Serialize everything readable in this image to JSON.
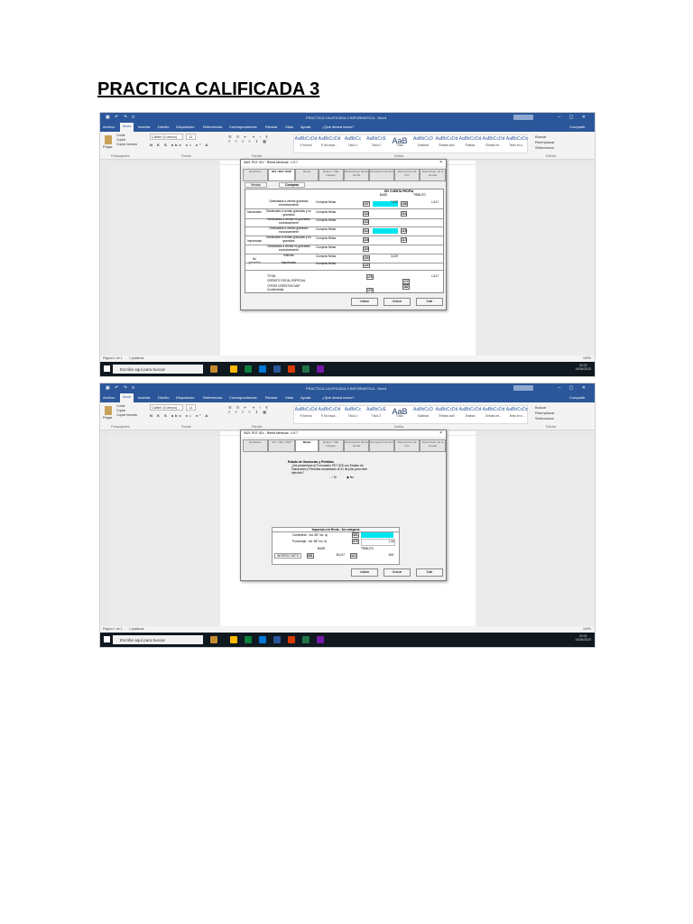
{
  "heading": "PRACTICA CALIFICADA 3",
  "word": {
    "doc_title": "PRACTICA CALIFICADA 3 INFORMATICA - Word",
    "share": "Compartir",
    "tabs": [
      "Archivo",
      "Inicio",
      "Insertar",
      "Diseño",
      "Disposición",
      "Referencias",
      "Correspondencia",
      "Revisar",
      "Vista",
      "Ayuda",
      "¿Qué desea hacer?"
    ],
    "clipboard": {
      "paste": "Pegar",
      "cut": "Cortar",
      "copy": "Copiar",
      "format": "Copiar formato",
      "label": "Portapapeles"
    },
    "font": {
      "name": "Calibri (Cuerpo)",
      "size": "11",
      "label": "Fuente"
    },
    "paragraph_label": "Párrafo",
    "styles_label": "Estilos",
    "edit_label": "Edición",
    "edit_items": [
      "Buscar",
      "Reemplazar",
      "Seleccionar"
    ],
    "styles": [
      {
        "preview": "AaBbCcDd",
        "name": "¶ Normal"
      },
      {
        "preview": "AaBbCcDd",
        "name": "¶ Sin espa..."
      },
      {
        "preview": "AaBbCc",
        "name": "Título 1"
      },
      {
        "preview": "AaBbCcE",
        "name": "Título 2"
      },
      {
        "preview": "AaB",
        "name": "Título"
      },
      {
        "preview": "AaBbCcD",
        "name": "Subtítulo"
      },
      {
        "preview": "AaBbCcDd",
        "name": "Énfasis sutil"
      },
      {
        "preview": "AaBbCcDd",
        "name": "Énfasis"
      },
      {
        "preview": "AaBbCcDd",
        "name": "Énfasis int..."
      },
      {
        "preview": "AaBbCcDc",
        "name": "Texto en n..."
      }
    ],
    "status": {
      "page": "Página 1 de 1",
      "words": "1 palabras",
      "zoom": "100%"
    },
    "taskbar": {
      "search": "Escribe aquí para buscar",
      "time": "20:02",
      "date": "14/06/2023"
    }
  },
  "dialog": {
    "title": "0621 PDT IGV - Renta Mensual - v 5.7",
    "close": "×",
    "tabs": [
      "Identificac.",
      "IGV / IEV / IVAP",
      "Renta",
      "Retenc. Trab. Indepen.",
      "Retenciones Renta de 5ta",
      "Percepción de IGV",
      "Retenciones de IGV",
      "Determinac. de la Deuda"
    ],
    "subtabs": [
      "Ventas",
      "Compras"
    ],
    "buttons": [
      "Validar",
      "Grabar",
      "Salir"
    ]
  },
  "compras": {
    "header_main": "IGV CUENTA PROPIA",
    "header_base": "BASE",
    "header_tributo": "TRIBUTO",
    "groups": [
      "Nacionales",
      "Importadas",
      "No gravadas"
    ],
    "rows": [
      {
        "desc": "Destinadas a ventas gravadas exclusivamente",
        "tipo": "Compras Netas",
        "c1": "107",
        "v1": "7,879",
        "c2": "108",
        "v2": "1,417",
        "cyan": true
      },
      {
        "desc": "Destinadas a ventas gravadas y no gravadas",
        "tipo": "Compras Netas",
        "c1": "110",
        "v1": "",
        "c2": "111",
        "v2": "",
        "cyan": false
      },
      {
        "desc": "Destinadas a ventas no gravadas exclusivamente",
        "tipo": "Compras Netas",
        "c1": "113",
        "v1": "",
        "c2": "",
        "v2": "",
        "cyan": false
      },
      {
        "desc": "Destinadas a ventas gravadas exclusivamente",
        "tipo": "Compras Netas",
        "c1": "114",
        "v1": "",
        "c2": "115",
        "v2": "",
        "cyan": true
      },
      {
        "desc": "Destinadas a ventas gravadas y no gravadas",
        "tipo": "Compras Netas",
        "c1": "116",
        "v1": "",
        "c2": "117",
        "v2": "",
        "cyan": false
      },
      {
        "desc": "Destinadas a ventas no gravadas exclusivamente",
        "tipo": "Compras Netas",
        "c1": "119",
        "v1": "",
        "c2": "",
        "v2": "",
        "cyan": false
      },
      {
        "desc": "Internas",
        "tipo": "Compras Netas",
        "c1": "120",
        "v1": "3,029",
        "c2": "",
        "v2": "",
        "cyan": false
      },
      {
        "desc": "Importadas",
        "tipo": "Compras Netas",
        "c1": "122",
        "v1": "",
        "c2": "",
        "v2": "",
        "cyan": false
      }
    ],
    "total": {
      "label": "TOTAL",
      "c": "178",
      "v": "1,417"
    },
    "credito": {
      "label": "CRÉDITO FISCAL ESPECIAL",
      "c": "172"
    },
    "otros": {
      "label": "OTROS CRÉDITOS IVAP",
      "c": "182"
    },
    "conformidad": {
      "label": "Conformidad",
      "c": "173"
    }
  },
  "renta": {
    "q_title": "Estado de Ganancias y Pérdidas",
    "q_text": "¿Ha presentado el Formulario PDT 625 con Estado de Ganancias y Pérdidas actualizado al 31 de julio para este ejercicio?",
    "opt_si": "Sí",
    "opt_no": "No",
    "table_title": "Impuesto a la Renta - 3ra categoría",
    "coef_label": "Coeficiente - Art. 85° inc. a)",
    "coef_code": "301",
    "pct_label": "Porcentaje - Art. 85° inc. b)",
    "pct_code": "375",
    "pct_value": "1.50",
    "base_label": "BASE",
    "tributo_label": "TRIBUTO",
    "ingreso_label": "INGRESO NETO",
    "ingreso_code": "301",
    "ingreso_value": "35,017",
    "tributo_code": "312",
    "tributo_value": "525"
  }
}
